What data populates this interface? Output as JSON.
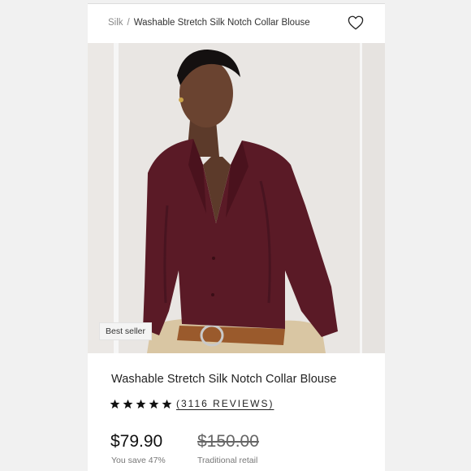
{
  "breadcrumb": {
    "parent": "Silk",
    "separator": "/",
    "current": "Washable Stretch Silk Notch Collar Blouse"
  },
  "wishlist": {
    "icon": "heart-icon"
  },
  "gallery": {
    "badge": "Best seller"
  },
  "product": {
    "title": "Washable Stretch Silk Notch Collar Blouse",
    "rating": 5,
    "reviews_label": "(3116 REVIEWS)",
    "price": "$79.90",
    "savings": "You save 47%",
    "original_price": "$150.00",
    "original_label": "Traditional retail"
  },
  "colors": {
    "blouse": "#5a1a26",
    "background": "#f1f1f1",
    "text": "#222222"
  }
}
